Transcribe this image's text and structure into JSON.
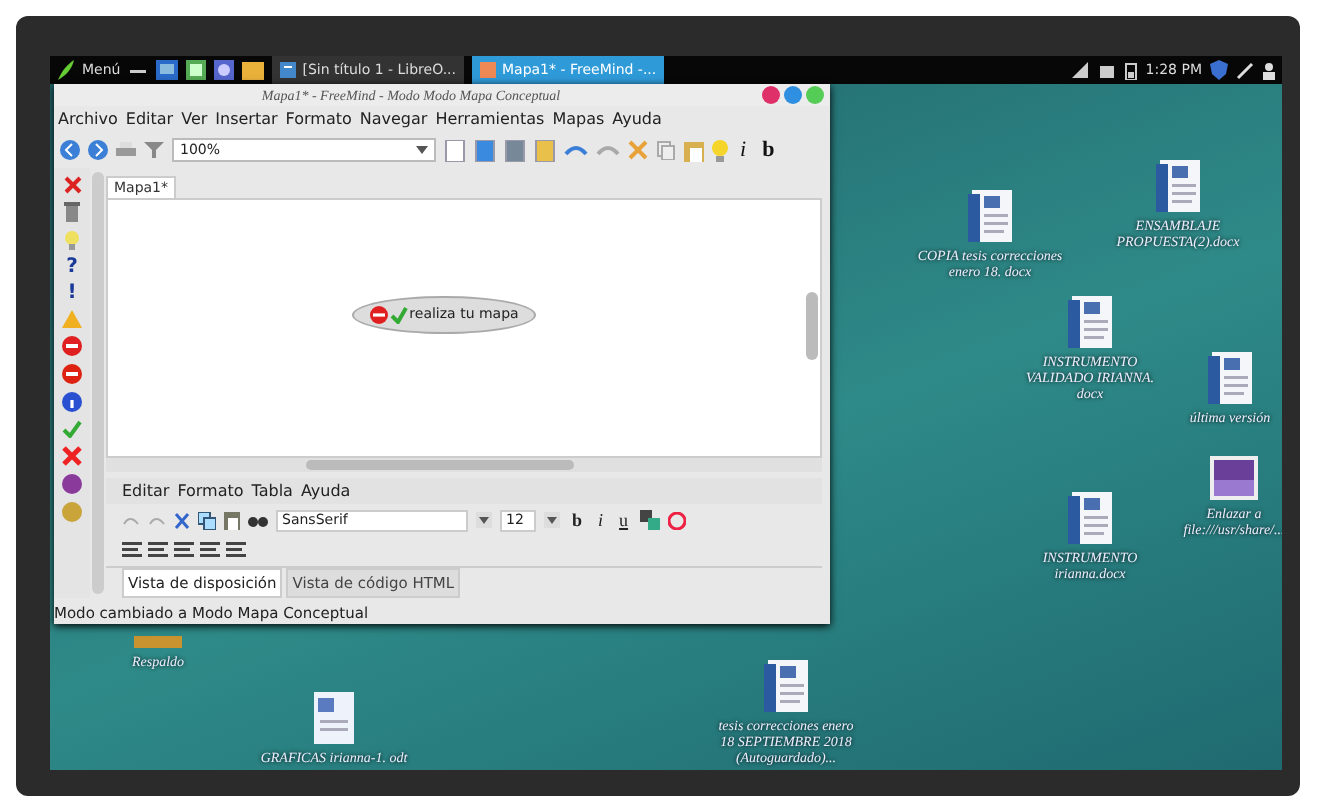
{
  "taskbar": {
    "menu_label": "Menú",
    "tasks": [
      {
        "label": "[Sin título 1 - LibreO...",
        "selected": false
      },
      {
        "label": "Mapa1* - FreeMind -...",
        "selected": true
      }
    ],
    "clock": "1:28 PM"
  },
  "window": {
    "title": "Mapa1* - FreeMind - Modo Modo Mapa Conceptual",
    "menu": [
      "Archivo",
      "Editar",
      "Ver",
      "Insertar",
      "Formato",
      "Navegar",
      "Herramientas",
      "Mapas",
      "Ayuda"
    ],
    "toolbar": {
      "zoom": "100%",
      "italic": "i",
      "bold": "b"
    },
    "side_palette": {
      "glyphs": [
        "?",
        "!"
      ]
    },
    "map_tabs": [
      {
        "label": "Mapa1*",
        "selected": true
      }
    ],
    "node": {
      "text": "realiza tu mapa"
    },
    "editor": {
      "menu": [
        "Editar",
        "Formato",
        "Tabla",
        "Ayuda"
      ],
      "font": "SansSerif",
      "size": "12",
      "bold": "b",
      "italic": "i",
      "underline": "u",
      "tabs": [
        {
          "label": "Vista de disposición",
          "selected": true
        },
        {
          "label": "Vista de código HTML",
          "selected": false
        }
      ]
    },
    "status_bar": "Modo cambiado a Modo Mapa Conceptual"
  },
  "desktop_icons": [
    {
      "kind": "doc",
      "label": "COPIA tesis correcciones enero 18. docx"
    },
    {
      "kind": "doc",
      "label": "ENSAMBLAJE PROPUESTA(2).docx"
    },
    {
      "kind": "doc",
      "label": "INSTRUMENTO VALIDADO IRIANNA. docx"
    },
    {
      "kind": "doc",
      "label": "última versión"
    },
    {
      "kind": "image",
      "label": "Enlazar a file:///usr/share/..."
    },
    {
      "kind": "doc",
      "label": "INSTRUMENTO irianna.docx"
    },
    {
      "kind": "folder",
      "label": "Respaldo"
    },
    {
      "kind": "odt",
      "label": "GRAFICAS irianna-1. odt"
    },
    {
      "kind": "doc",
      "label": "tesis correcciones enero 18 SEPTIEMBRE 2018 (Autoguardado)..."
    }
  ]
}
